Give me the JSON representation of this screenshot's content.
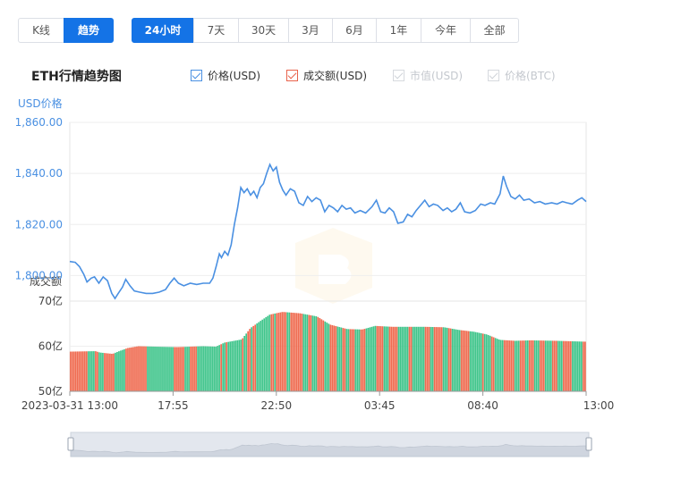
{
  "tabs": {
    "mode": [
      {
        "label": "K线",
        "active": false
      },
      {
        "label": "趋势",
        "active": true
      }
    ],
    "ranges": [
      {
        "label": "24小时",
        "active": true
      },
      {
        "label": "7天",
        "active": false
      },
      {
        "label": "30天",
        "active": false
      },
      {
        "label": "3月",
        "active": false
      },
      {
        "label": "6月",
        "active": false
      },
      {
        "label": "1年",
        "active": false
      },
      {
        "label": "今年",
        "active": false
      },
      {
        "label": "全部",
        "active": false
      }
    ]
  },
  "title": "ETH行情趋势图",
  "legend": [
    {
      "label": "价格(USD)",
      "checked": true,
      "color": "#4a90e2",
      "enabled": true
    },
    {
      "label": "成交额(USD)",
      "checked": true,
      "color": "#e8624b",
      "enabled": true
    },
    {
      "label": "市值(USD)",
      "checked": true,
      "color": "#cfd3d9",
      "enabled": false
    },
    {
      "label": "价格(BTC)",
      "checked": true,
      "color": "#cfd3d9",
      "enabled": false
    }
  ],
  "colors": {
    "price_line": "#4a90e2",
    "volume_up": "#3ec48a",
    "volume_down": "#ef6a4f",
    "axis_text": "#4a90e2",
    "grid": "#eeeeee",
    "navigator_fill": "#d9dde5"
  },
  "chart_data": [
    {
      "type": "line",
      "name": "价格(USD)",
      "ylabel": "USD价格",
      "ylim": [
        1790,
        1860
      ],
      "yticks": [
        "1,860.00",
        "1,840.00",
        "1,820.00",
        "1,800.00"
      ],
      "x_ticks": [
        "2023-03-31 13:00",
        "17:55",
        "22:50",
        "03:45",
        "08:40",
        "13:00"
      ],
      "x_hours": [
        0,
        24
      ],
      "points": [
        [
          0.0,
          1805.5
        ],
        [
          0.25,
          1805.2
        ],
        [
          0.45,
          1803.5
        ],
        [
          0.65,
          1800.5
        ],
        [
          0.8,
          1797.5
        ],
        [
          1.0,
          1799.0
        ],
        [
          1.15,
          1799.5
        ],
        [
          1.35,
          1797.0
        ],
        [
          1.55,
          1799.5
        ],
        [
          1.75,
          1798.0
        ],
        [
          1.95,
          1793.0
        ],
        [
          2.1,
          1791.0
        ],
        [
          2.25,
          1793.0
        ],
        [
          2.45,
          1795.5
        ],
        [
          2.6,
          1798.5
        ],
        [
          2.8,
          1796.0
        ],
        [
          3.0,
          1794.0
        ],
        [
          3.25,
          1793.5
        ],
        [
          3.55,
          1793.0
        ],
        [
          3.85,
          1793.0
        ],
        [
          4.15,
          1793.5
        ],
        [
          4.45,
          1794.5
        ],
        [
          4.65,
          1797.0
        ],
        [
          4.85,
          1799.0
        ],
        [
          5.05,
          1797.0
        ],
        [
          5.3,
          1796.0
        ],
        [
          5.6,
          1797.0
        ],
        [
          5.9,
          1796.5
        ],
        [
          6.2,
          1797.0
        ],
        [
          6.5,
          1797.0
        ],
        [
          6.65,
          1799.0
        ],
        [
          6.8,
          1803.5
        ],
        [
          6.95,
          1808.5
        ],
        [
          7.05,
          1807.0
        ],
        [
          7.2,
          1809.5
        ],
        [
          7.35,
          1808.0
        ],
        [
          7.5,
          1812.0
        ],
        [
          7.65,
          1820.0
        ],
        [
          7.8,
          1826.5
        ],
        [
          7.95,
          1834.5
        ],
        [
          8.1,
          1832.5
        ],
        [
          8.25,
          1834.0
        ],
        [
          8.4,
          1831.5
        ],
        [
          8.55,
          1833.0
        ],
        [
          8.7,
          1830.5
        ],
        [
          8.85,
          1834.5
        ],
        [
          9.0,
          1836.0
        ],
        [
          9.15,
          1840.0
        ],
        [
          9.3,
          1843.5
        ],
        [
          9.45,
          1841.0
        ],
        [
          9.6,
          1842.5
        ],
        [
          9.75,
          1836.5
        ],
        [
          9.9,
          1833.5
        ],
        [
          10.05,
          1831.5
        ],
        [
          10.25,
          1834.0
        ],
        [
          10.45,
          1833.0
        ],
        [
          10.65,
          1828.5
        ],
        [
          10.85,
          1827.5
        ],
        [
          11.05,
          1831.0
        ],
        [
          11.25,
          1829.0
        ],
        [
          11.45,
          1830.5
        ],
        [
          11.65,
          1829.5
        ],
        [
          11.85,
          1825.0
        ],
        [
          12.05,
          1827.5
        ],
        [
          12.25,
          1826.5
        ],
        [
          12.45,
          1825.0
        ],
        [
          12.65,
          1827.5
        ],
        [
          12.85,
          1826.0
        ],
        [
          13.05,
          1826.5
        ],
        [
          13.25,
          1824.5
        ],
        [
          13.5,
          1825.5
        ],
        [
          13.75,
          1824.5
        ],
        [
          14.05,
          1827.0
        ],
        [
          14.25,
          1829.5
        ],
        [
          14.45,
          1825.0
        ],
        [
          14.65,
          1824.5
        ],
        [
          14.85,
          1826.5
        ],
        [
          15.05,
          1825.0
        ],
        [
          15.25,
          1820.5
        ],
        [
          15.5,
          1821.0
        ],
        [
          15.7,
          1824.0
        ],
        [
          15.9,
          1823.0
        ],
        [
          16.1,
          1825.5
        ],
        [
          16.3,
          1827.5
        ],
        [
          16.5,
          1829.5
        ],
        [
          16.7,
          1827.0
        ],
        [
          16.9,
          1828.0
        ],
        [
          17.1,
          1827.5
        ],
        [
          17.35,
          1825.5
        ],
        [
          17.55,
          1826.5
        ],
        [
          17.75,
          1825.0
        ],
        [
          17.95,
          1826.0
        ],
        [
          18.15,
          1828.5
        ],
        [
          18.35,
          1825.0
        ],
        [
          18.6,
          1824.5
        ],
        [
          18.85,
          1825.5
        ],
        [
          19.1,
          1828.0
        ],
        [
          19.3,
          1827.5
        ],
        [
          19.55,
          1828.5
        ],
        [
          19.75,
          1828.0
        ],
        [
          20.0,
          1832.0
        ],
        [
          20.15,
          1839.0
        ],
        [
          20.3,
          1835.0
        ],
        [
          20.5,
          1831.0
        ],
        [
          20.7,
          1830.0
        ],
        [
          20.9,
          1831.5
        ],
        [
          21.1,
          1829.5
        ],
        [
          21.35,
          1830.0
        ],
        [
          21.6,
          1828.5
        ],
        [
          21.85,
          1829.0
        ],
        [
          22.1,
          1828.0
        ],
        [
          22.4,
          1828.5
        ],
        [
          22.65,
          1828.0
        ],
        [
          22.9,
          1829.0
        ],
        [
          23.1,
          1828.5
        ],
        [
          23.35,
          1828.0
        ],
        [
          23.6,
          1829.5
        ],
        [
          23.8,
          1830.5
        ],
        [
          24.0,
          1829.0
        ]
      ]
    },
    {
      "type": "bar",
      "name": "成交额(USD)",
      "ylabel": "成交额",
      "ylim": [
        50,
        70
      ],
      "yticks": [
        "70亿",
        "60亿",
        "50亿"
      ],
      "unit": "亿",
      "anchors": [
        [
          0.0,
          58.8
        ],
        [
          1.2,
          58.9
        ],
        [
          1.4,
          58.6
        ],
        [
          2.0,
          58.3
        ],
        [
          2.3,
          58.9
        ],
        [
          2.7,
          59.6
        ],
        [
          3.2,
          60.0
        ],
        [
          4.0,
          59.9
        ],
        [
          5.0,
          59.8
        ],
        [
          6.2,
          60.0
        ],
        [
          6.8,
          59.9
        ],
        [
          7.2,
          60.8
        ],
        [
          8.0,
          61.5
        ],
        [
          8.4,
          64.0
        ],
        [
          8.9,
          65.7
        ],
        [
          9.3,
          67.0
        ],
        [
          9.9,
          67.6
        ],
        [
          10.7,
          67.3
        ],
        [
          11.5,
          66.6
        ],
        [
          12.1,
          64.8
        ],
        [
          12.9,
          63.8
        ],
        [
          13.6,
          63.7
        ],
        [
          14.2,
          64.5
        ],
        [
          15.0,
          64.3
        ],
        [
          16.5,
          64.3
        ],
        [
          17.4,
          64.2
        ],
        [
          18.1,
          63.6
        ],
        [
          18.8,
          63.2
        ],
        [
          19.4,
          62.6
        ],
        [
          20.0,
          61.4
        ],
        [
          20.7,
          61.2
        ],
        [
          21.4,
          61.3
        ],
        [
          22.6,
          61.2
        ],
        [
          24.0,
          61.0
        ]
      ]
    }
  ]
}
